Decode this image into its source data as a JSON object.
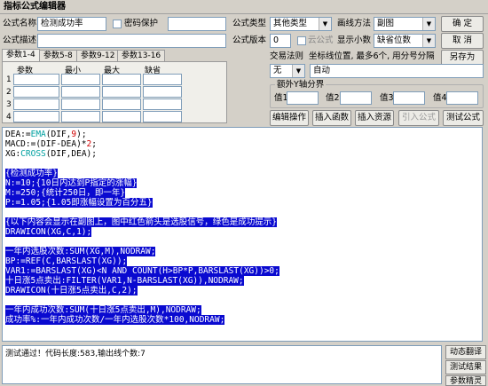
{
  "window": {
    "title": "指标公式编辑器"
  },
  "top": {
    "name_label": "公式名称",
    "name_value": "检测成功率",
    "password_label": "密码保护",
    "desc_label": "公式描述",
    "desc_value": "",
    "type_label": "公式类型",
    "type_value": "其他类型",
    "draw_label": "画线方法",
    "draw_value": "副图",
    "version_label": "公式版本",
    "version_value": "0",
    "cloud_label": "云公式",
    "decimal_label": "显示小数",
    "decimal_value": "缺省位数",
    "trade_label": "交易法则",
    "coord_label": "坐标线位置, 最多6个, 用分号分隔",
    "trade_value": "无",
    "coord_value": "自动",
    "extra_axis_label": "额外Y轴分界",
    "val1": "值1",
    "val2": "值2",
    "val3": "值3",
    "val4": "值4"
  },
  "buttons": {
    "ok": "确  定",
    "cancel": "取  消",
    "save_as": "另存为",
    "edit_op": "编辑操作",
    "insert_func": "插入函数",
    "insert_res": "插入资源",
    "import_formula": "引入公式",
    "test_formula": "测试公式",
    "dyn_translate": "动态翻译",
    "test_result": "测试结果",
    "param_wizard": "参数精灵"
  },
  "tabs": [
    "参数1-4",
    "参数5-8",
    "参数9-12",
    "参数13-16"
  ],
  "params": {
    "headers": [
      "参数",
      "最小",
      "最大",
      "缺省"
    ],
    "rows": [
      "1",
      "2",
      "3",
      "4"
    ]
  },
  "code": {
    "line1": [
      "DEA:=",
      "EMA",
      "(DIF,",
      "9",
      ");"
    ],
    "line2": [
      "MACD:=(DIF-DEA)*",
      "2",
      ";"
    ],
    "line3": [
      "XG:",
      "CROSS",
      "(DIF,DEA);"
    ],
    "h1": "{检测成功率}",
    "h2": "N:=10;{10日内达到P指定的涨幅}",
    "h3": "M:=250;{统计250日，即一年}",
    "h4": "P:=1.05;{1.05即涨幅设置为百分五}",
    "h5": "{以下内容会显示在副图上，图中红色箭头是选股信号，绿色是成功提示}",
    "h6": "DRAWICON(XG,C,1);",
    "h7": "一年内选股次数:SUM(XG,M),NODRAW;",
    "h8": "BP:=REF(C,BARSLAST(XG));",
    "h9": "VAR1:=BARSLAST(XG)<N AND COUNT(H>BP*P,BARSLAST(XG))>0;",
    "h10": "十日涨5点卖出:FILTER(VAR1,N-BARSLAST(XG)),NODRAW;",
    "h11": "DRAWICON(十日涨5点卖出,C,2);",
    "h12": "一年内成功次数:SUM(十日涨5点卖出,M),NODRAW;",
    "h13": "成功率%:一年内成功次数/一年内选股次数*100,NODRAW;"
  },
  "status": {
    "message": "测试通过！代码长度:583,输出线个数:7"
  }
}
